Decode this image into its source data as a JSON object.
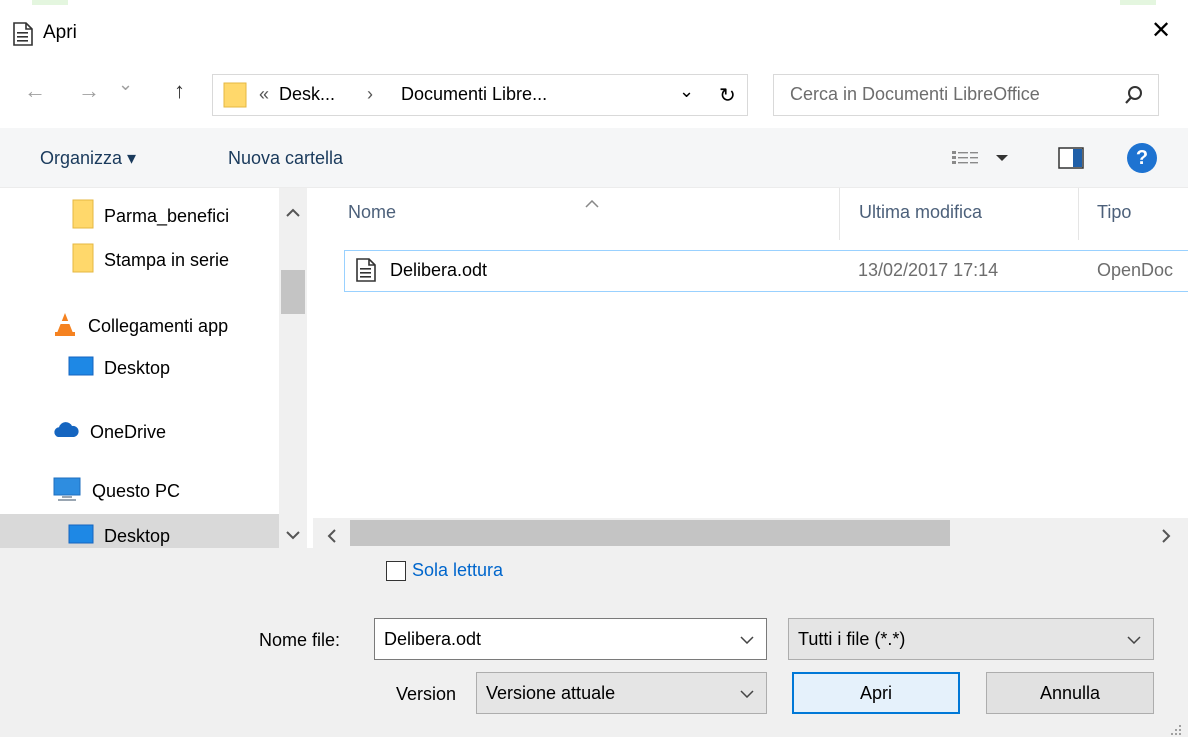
{
  "window": {
    "title": "Apri",
    "close_glyph": "✕"
  },
  "nav": {
    "back_glyph": "←",
    "forward_glyph": "→",
    "recent_glyph": "⌄",
    "up_glyph": "↑"
  },
  "address": {
    "overflow_glyph": "«",
    "crumbs": [
      "Desk...",
      "Documenti Libre..."
    ],
    "separator": "›",
    "dropdown_glyph": "⌄",
    "refresh_glyph": "↻"
  },
  "search": {
    "placeholder": "Cerca in Documenti LibreOffice"
  },
  "toolbar": {
    "organize_label": "Organizza ▾",
    "new_folder_label": "Nuova cartella",
    "help_glyph": "?"
  },
  "sidebar": {
    "items": [
      {
        "label": "Parma_benefici",
        "icon": "folder-icon"
      },
      {
        "label": "Stampa in serie",
        "icon": "folder-icon"
      },
      {
        "label": "Collegamenti app",
        "icon": "vlc-cone-icon"
      },
      {
        "label": "Desktop",
        "icon": "desktop-icon"
      },
      {
        "label": "OneDrive",
        "icon": "onedrive-cloud-icon"
      },
      {
        "label": "Questo PC",
        "icon": "computer-icon"
      },
      {
        "label": "Desktop",
        "icon": "desktop-icon"
      }
    ]
  },
  "file_list": {
    "columns": [
      "Nome",
      "Ultima modifica",
      "Tipo"
    ],
    "rows": [
      {
        "name": "Delibera.odt",
        "modified": "13/02/2017 17:14",
        "type": "OpenDoc"
      }
    ]
  },
  "options": {
    "read_only_label": "Sola lettura"
  },
  "footer": {
    "filename_label": "Nome file:",
    "filename_value": "Delibera.odt",
    "filter_value": "Tutti i file (*.*)",
    "version_label": "Version",
    "version_value": "Versione attuale",
    "open_button": "Apri",
    "cancel_button": "Annulla"
  },
  "colors": {
    "accent_link": "#0066cc",
    "selection_border": "#99d1ff",
    "folder_yellow": "#ffd86b",
    "help_blue": "#1e73d1"
  }
}
